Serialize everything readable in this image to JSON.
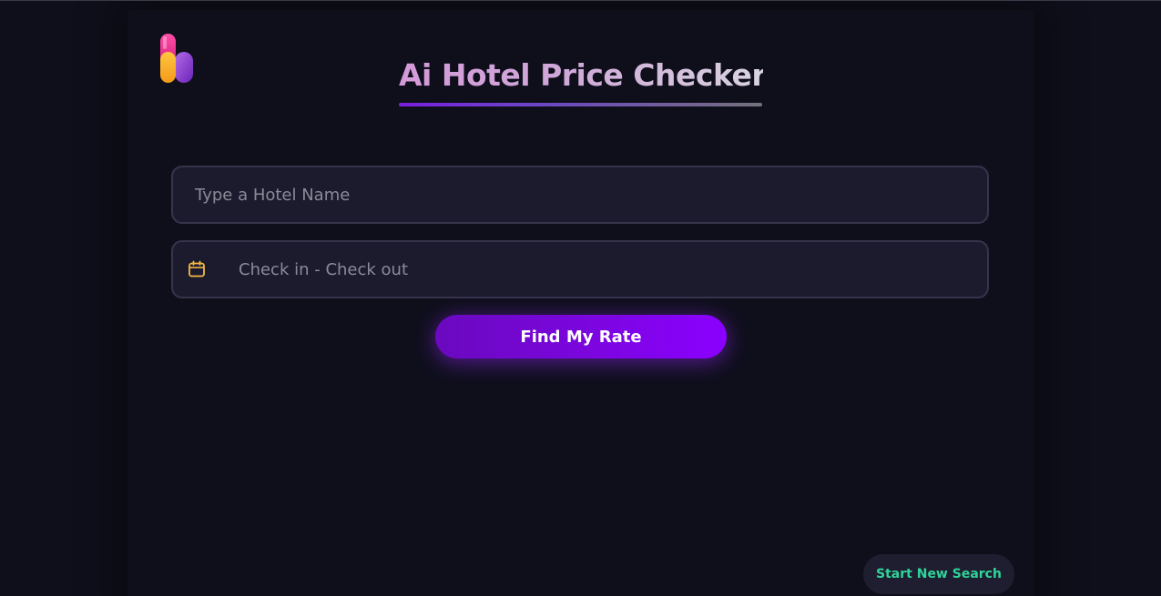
{
  "header": {
    "title": "Ai Hotel Price Checker",
    "logo_icon": "hotel-logo-icon"
  },
  "search": {
    "hotel_placeholder": "Type a Hotel Name",
    "hotel_value": "",
    "dates_placeholder": "Check in - Check out",
    "dates_value": "",
    "calendar_icon": "calendar-icon"
  },
  "actions": {
    "find_label": "Find My Rate",
    "new_search_label": "Start New Search"
  },
  "colors": {
    "background": "#0f0f1b",
    "accent_purple": "#8b00ff",
    "accent_green": "#2fd49a",
    "calendar_icon": "#f5b942"
  }
}
